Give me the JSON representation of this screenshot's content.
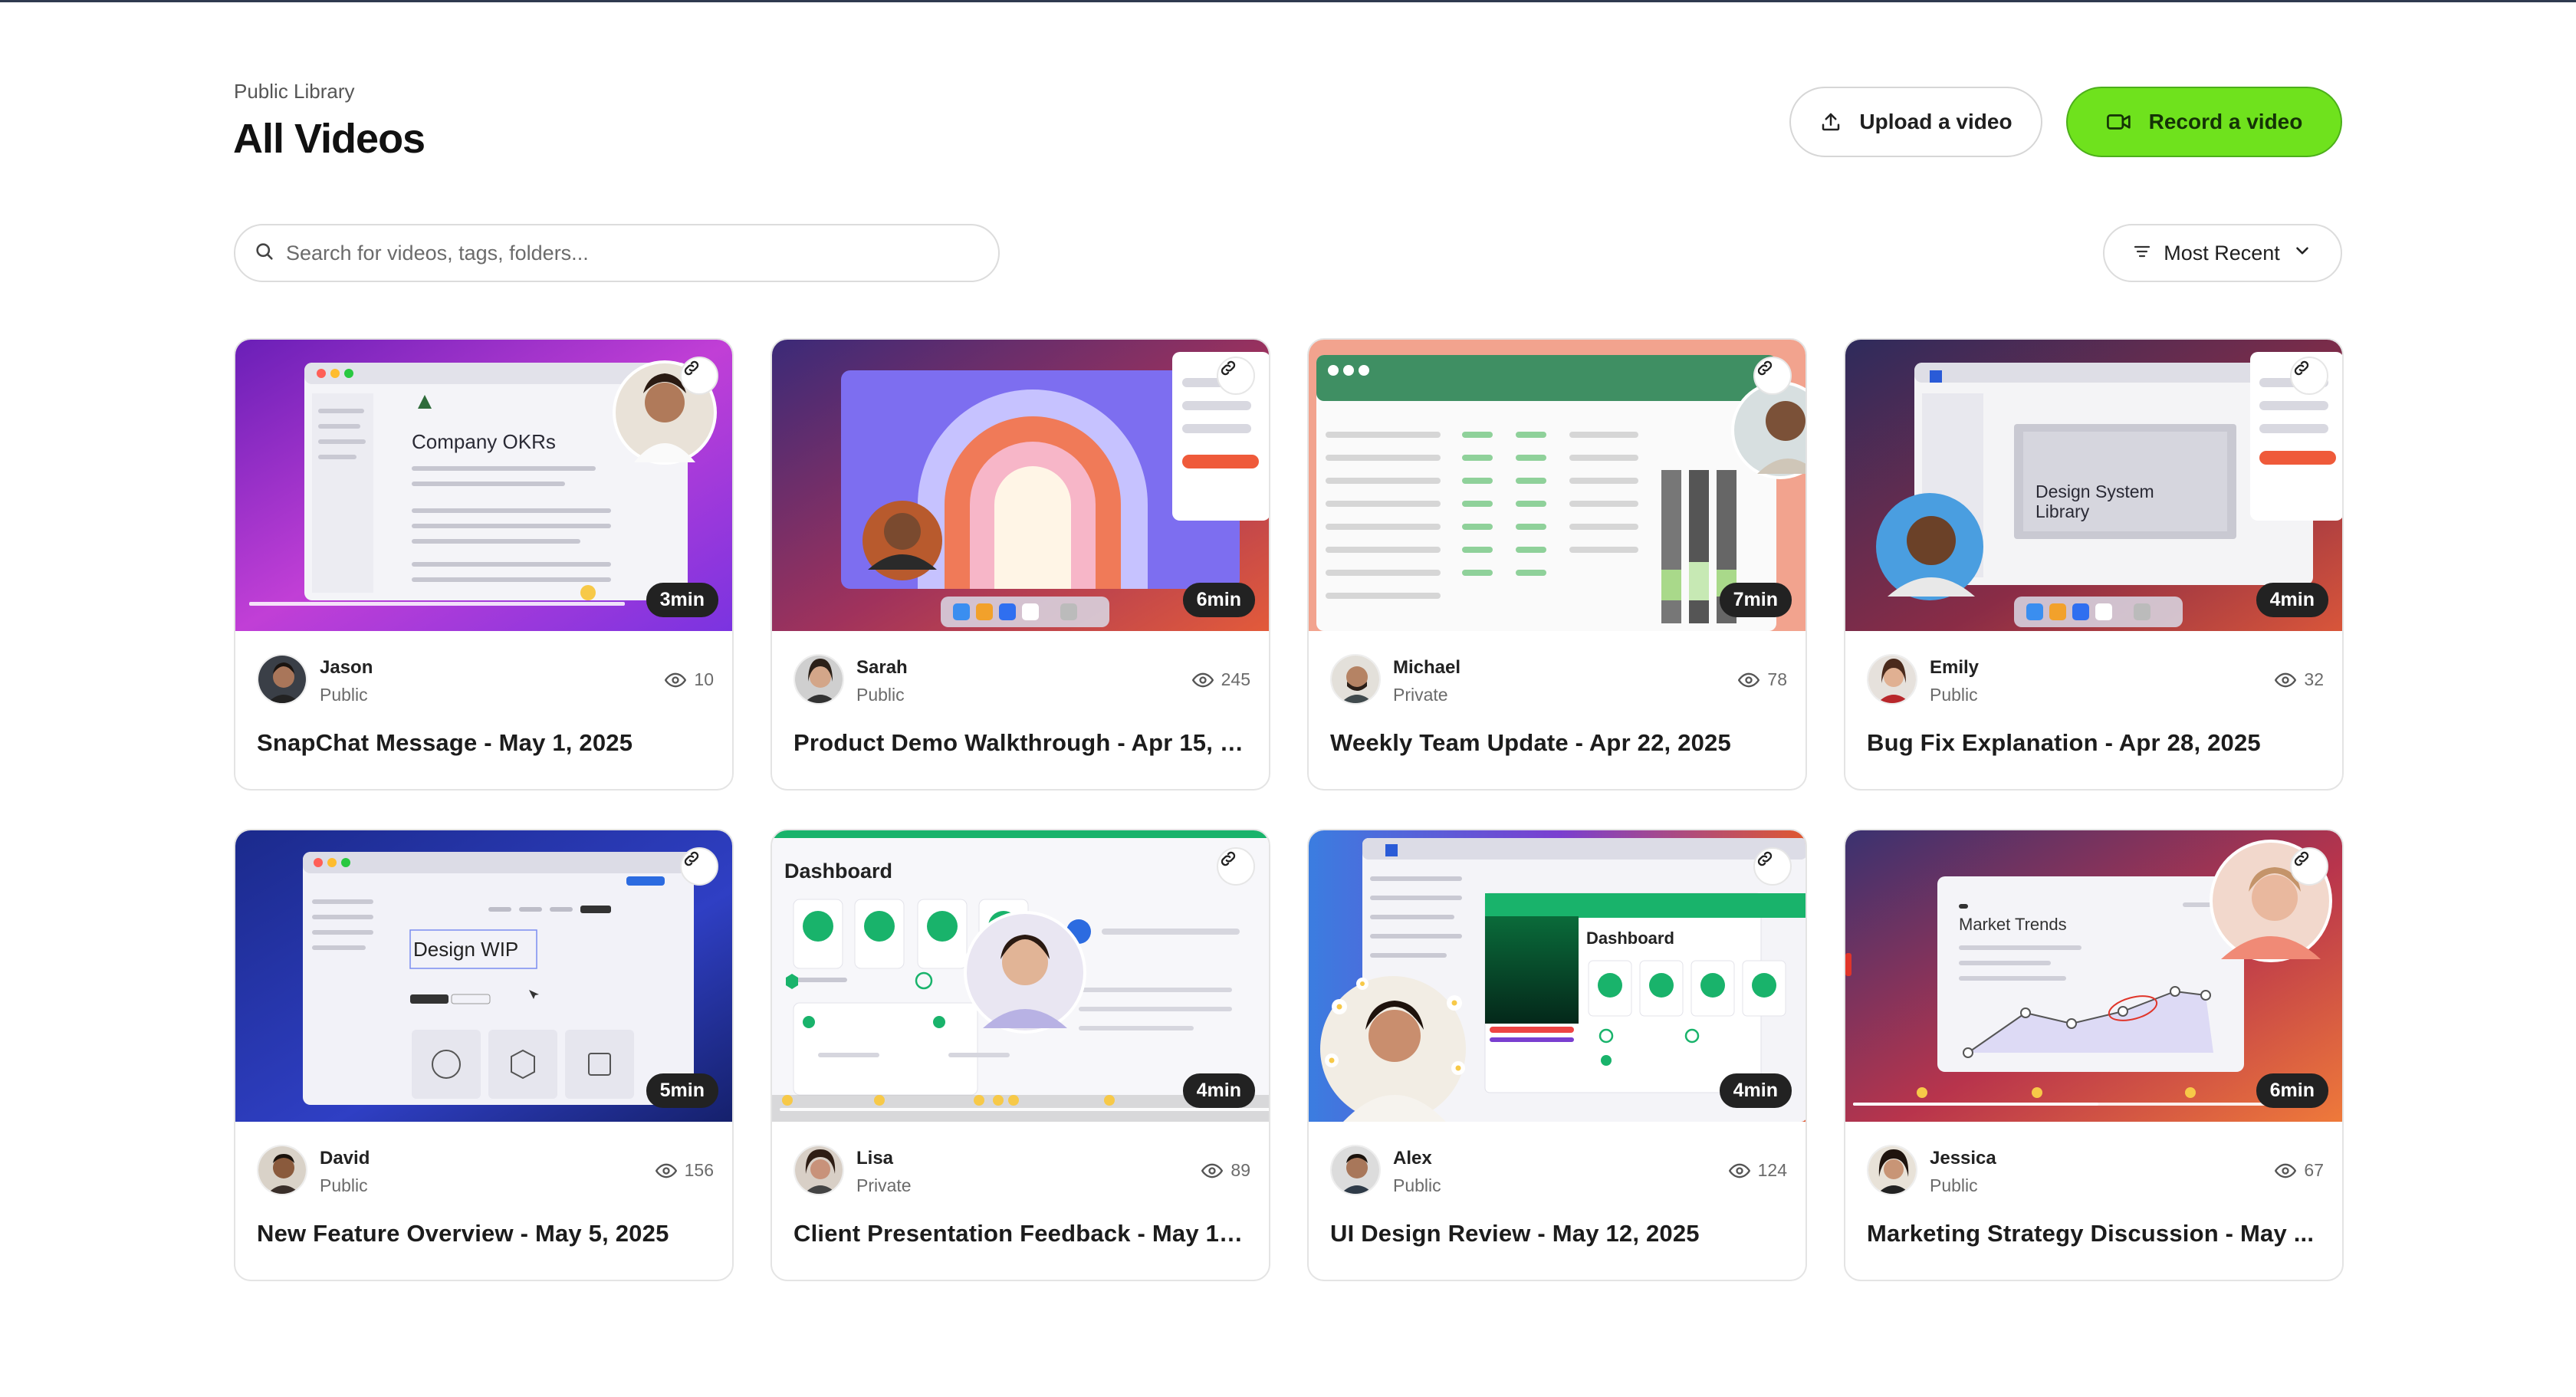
{
  "header": {
    "breadcrumb": "Public Library",
    "title": "All Videos",
    "upload_label": "Upload a video",
    "record_label": "Record a video"
  },
  "search": {
    "placeholder": "Search for videos, tags, folders..."
  },
  "sort": {
    "label": "Most Recent"
  },
  "colors": {
    "record_button": "#6fe21d",
    "accent_dark": "#222222"
  },
  "videos": [
    {
      "author": "Jason",
      "visibility": "Public",
      "views": "10",
      "duration": "3min",
      "title": "SnapChat Message - May 1, 2025",
      "thumb_text": "Company OKRs"
    },
    {
      "author": "Sarah",
      "visibility": "Public",
      "views": "245",
      "duration": "6min",
      "title": "Product Demo Walkthrough - Apr 15, 2...",
      "thumb_text": ""
    },
    {
      "author": "Michael",
      "visibility": "Private",
      "views": "78",
      "duration": "7min",
      "title": "Weekly Team Update - Apr 22, 2025",
      "thumb_text": ""
    },
    {
      "author": "Emily",
      "visibility": "Public",
      "views": "32",
      "duration": "4min",
      "title": "Bug Fix Explanation - Apr 28, 2025",
      "thumb_text": "Design System Library"
    },
    {
      "author": "David",
      "visibility": "Public",
      "views": "156",
      "duration": "5min",
      "title": "New Feature Overview - May 5, 2025",
      "thumb_text": "Design WIP"
    },
    {
      "author": "Lisa",
      "visibility": "Private",
      "views": "89",
      "duration": "4min",
      "title": "Client Presentation Feedback - May 10...",
      "thumb_text": "Dashboard"
    },
    {
      "author": "Alex",
      "visibility": "Public",
      "views": "124",
      "duration": "4min",
      "title": "UI Design Review - May 12, 2025",
      "thumb_text": "Dashboard"
    },
    {
      "author": "Jessica",
      "visibility": "Public",
      "views": "67",
      "duration": "6min",
      "title": "Marketing Strategy Discussion - May ...",
      "thumb_text": "Market Trends"
    }
  ]
}
